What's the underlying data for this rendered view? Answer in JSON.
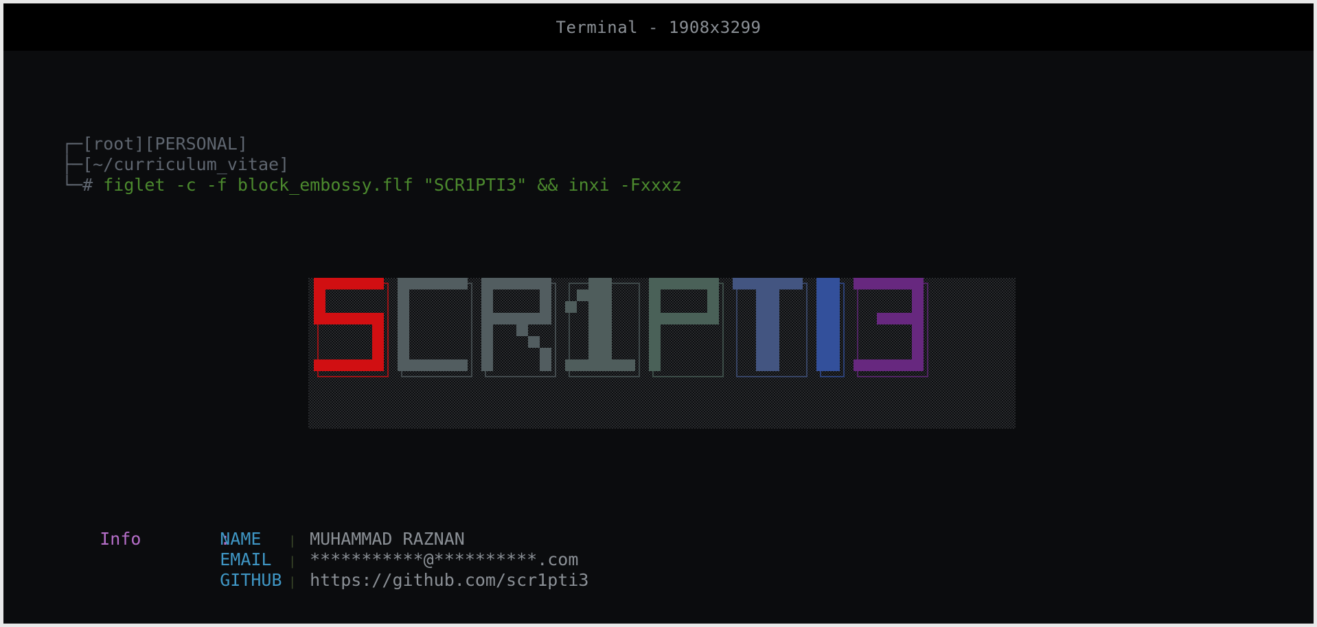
{
  "window": {
    "title": "Terminal - 1908x3299"
  },
  "prompt": {
    "line1": "┌─[root][PERSONAL]",
    "line2": "├─[~/curriculum_vitae]",
    "line3_prefix": "└─# ",
    "command": "figlet -c -f block_embossy.flf \"SCR1PTI3\" && inxi -Fxxxz"
  },
  "banner": {
    "text": "SCR1PTI3",
    "letters": [
      {
        "char": "S",
        "color": "#d10f12"
      },
      {
        "char": "C",
        "color": "#525d60"
      },
      {
        "char": "R",
        "color": "#525d60"
      },
      {
        "char": "1",
        "color": "#4f5d5c"
      },
      {
        "char": "P",
        "color": "#4a6158"
      },
      {
        "char": "T",
        "color": "#435581"
      },
      {
        "char": "I",
        "color": "#33509b"
      },
      {
        "char": "3",
        "color": "#67287f"
      }
    ]
  },
  "info": {
    "label": "Info",
    "colon": ":",
    "separator": "|",
    "rows": [
      {
        "key": "NAME",
        "value": "MUHAMMAD RAZNAN"
      },
      {
        "key": "EMAIL",
        "value": "***********@**********.com"
      },
      {
        "key": "GITHUB",
        "value": "https://github.com/scr1pti3"
      }
    ]
  },
  "colors": {
    "background": "#0b0c0e",
    "titlebar": "#000000",
    "prompt": "#5f6670",
    "command": "#4c8a2e",
    "info_label": "#b56ec8",
    "info_key": "#3f96c4",
    "info_value": "#8b9096"
  }
}
